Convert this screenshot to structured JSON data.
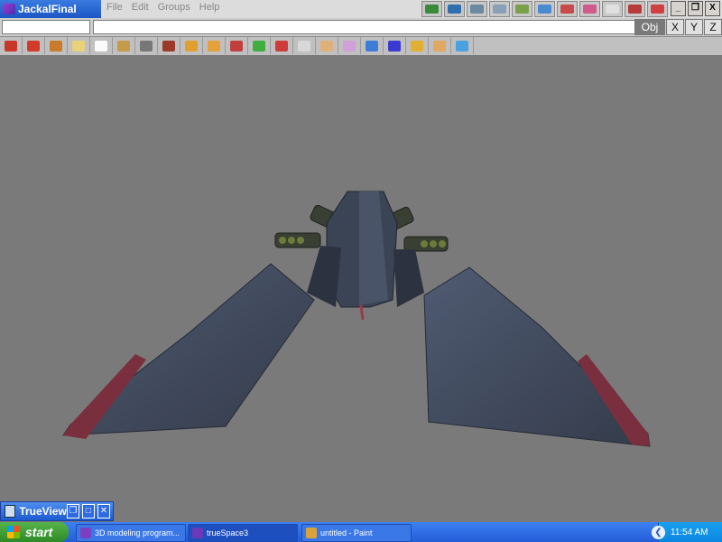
{
  "window": {
    "title": "JackalFinal"
  },
  "menu": [
    "File",
    "Edit",
    "Groups",
    "Help"
  ],
  "axis": {
    "obj": "Obj",
    "x": "X",
    "y": "Y",
    "z": "Z"
  },
  "window_controls": {
    "minimize": "_",
    "restore": "❐",
    "close": "X"
  },
  "topbar_icons": [
    "render-icon",
    "paint-icon",
    "fly-icon",
    "orbit-icon",
    "settings-icon",
    "library-icon",
    "materials-icon",
    "palette-icon",
    "display-icon",
    "network-icon",
    "help-icon"
  ],
  "toolbar_icons": [
    {
      "name": "erase-icon",
      "color": "#c8382a"
    },
    {
      "name": "delete-icon",
      "color": "#d23a2a"
    },
    {
      "name": "object-box-icon",
      "color": "#c97a2a"
    },
    {
      "name": "light-bulb-icon",
      "color": "#e8d27a"
    },
    {
      "name": "pointer-icon",
      "color": "#fafafa"
    },
    {
      "name": "rotate-object-icon",
      "color": "#c59a4a"
    },
    {
      "name": "move-down-icon",
      "color": "#777777"
    },
    {
      "name": "cube-icon",
      "color": "#9c3a2a"
    },
    {
      "name": "prism-icon",
      "color": "#e0a030"
    },
    {
      "name": "sphere-icon",
      "color": "#e6a13a"
    },
    {
      "name": "material-sphere-icon",
      "color": "#c23f3f"
    },
    {
      "name": "blob-icon",
      "color": "#3fae3f"
    },
    {
      "name": "paint-brush-icon",
      "color": "#cf3b3b"
    },
    {
      "name": "path-icon",
      "color": "#d8d8d8"
    },
    {
      "name": "deform-icon",
      "color": "#e0b07a"
    },
    {
      "name": "texture-icon",
      "color": "#d0a0d8"
    },
    {
      "name": "color-balls-icon",
      "color": "#3d7dd8"
    },
    {
      "name": "grid-icon",
      "color": "#3a3ad0"
    },
    {
      "name": "gears-icon",
      "color": "#e2b030"
    },
    {
      "name": "plane-icon",
      "color": "#e0a860"
    },
    {
      "name": "render-3d-icon",
      "color": "#4aa0e0"
    }
  ],
  "trueview": {
    "label": "TrueView"
  },
  "taskbar": {
    "start": "start",
    "tasks": [
      {
        "label": "3D modeling program...",
        "color": "#7b3fc0"
      },
      {
        "label": "trueSpace3",
        "color": "#6a3ab8"
      },
      {
        "label": "untitled - Paint",
        "color": "#d8a43a"
      }
    ],
    "clock": "11:54 AM"
  }
}
